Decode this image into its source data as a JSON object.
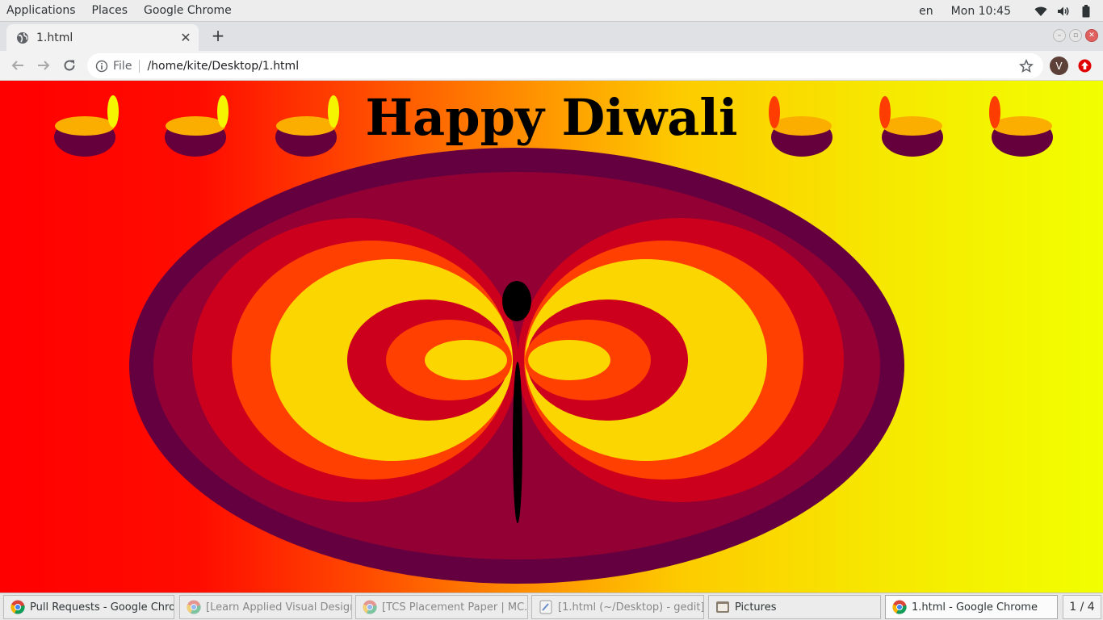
{
  "topbar": {
    "menu": [
      "Applications",
      "Places",
      "Google Chrome"
    ],
    "lang": "en",
    "clock": "Mon 10:45"
  },
  "browser": {
    "tab_title": "1.html",
    "omnibox_scheme": "File",
    "url": "/home/kite/Desktop/1.html",
    "profile_initial": "V"
  },
  "page": {
    "heading": "Happy Diwali",
    "colors": {
      "gradient_left": "#ff0000",
      "gradient_right": "#f2ff00",
      "rangoli_outer": "#650040",
      "rangoli_main": "#920034",
      "ring_crimson": "#cc001c",
      "ring_orange": "#ff4000",
      "ring_yellow": "#fcd600",
      "diya_bowl": "#65003d",
      "diya_oil": "#fbae00",
      "flame_left": "#f5f500",
      "flame_right": "#ff3d00"
    }
  },
  "taskbar": {
    "tasks": [
      {
        "label": "Pull Requests - Google Chro...",
        "icon": "chrome-icon",
        "state": "normal"
      },
      {
        "label": "[Learn Applied Visual Design:...",
        "icon": "chrome-icon",
        "state": "minimized"
      },
      {
        "label": "[TCS Placement Paper | MC...",
        "icon": "chrome-icon",
        "state": "minimized"
      },
      {
        "label": "[1.html (~/Desktop) - gedit]",
        "icon": "gedit-icon",
        "state": "minimized"
      },
      {
        "label": "Pictures",
        "icon": "folder-icon",
        "state": "normal"
      },
      {
        "label": "1.html - Google Chrome",
        "icon": "chrome-icon",
        "state": "active"
      }
    ],
    "workspace": "1 / 4"
  }
}
